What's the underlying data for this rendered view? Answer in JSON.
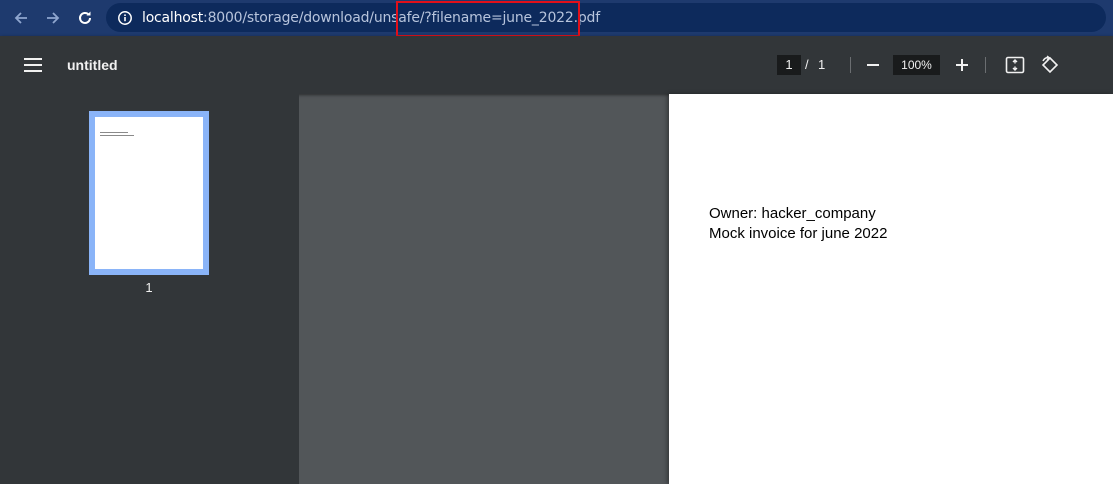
{
  "browser": {
    "url_host": "localhost",
    "url_path": ":8000/storage/download/unsafe/?filename=june_2022.pdf",
    "back_icon": "arrow-left-icon",
    "forward_icon": "arrow-right-icon",
    "reload_icon": "reload-icon",
    "site_info_icon": "info-icon",
    "highlight_color": "#e2101a"
  },
  "pdf_toolbar": {
    "menu_icon": "hamburger-menu-icon",
    "title": "untitled",
    "current_page": "1",
    "page_separator": "/",
    "total_pages": "1",
    "zoom_out_icon": "minus-icon",
    "zoom_level": "100%",
    "zoom_in_icon": "plus-icon",
    "fit_icon": "fit-to-page-icon",
    "rotate_icon": "rotate-icon"
  },
  "sidebar": {
    "thumbnails": [
      {
        "label": "1"
      }
    ]
  },
  "document": {
    "lines": [
      "Owner: hacker_company",
      "Mock invoice for june 2022"
    ]
  }
}
